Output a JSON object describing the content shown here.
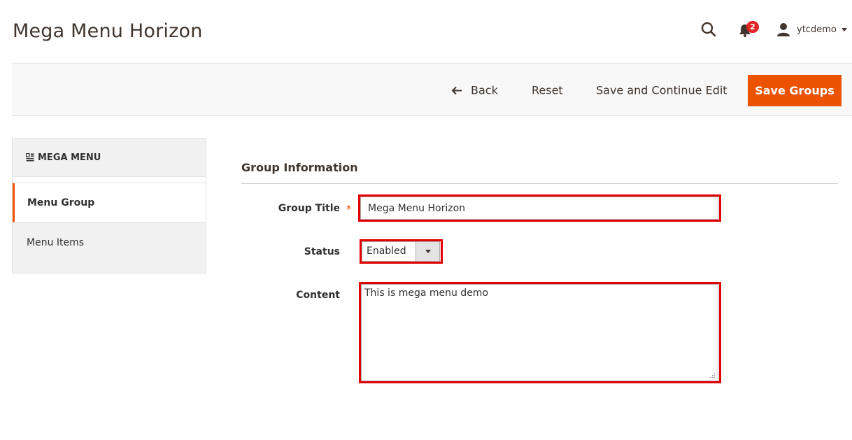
{
  "header": {
    "title": "Mega Menu Horizon",
    "notifications_count": "2",
    "user_name": "ytcdemo",
    "icons": [
      "search-icon",
      "bell-icon",
      "user-icon",
      "chevron-down-icon"
    ]
  },
  "actions": {
    "back_label": "Back",
    "reset_label": "Reset",
    "save_continue_label": "Save and Continue Edit",
    "save_groups_label": "Save Groups"
  },
  "sidebar": {
    "title": "MEGA MENU",
    "items": [
      {
        "label": "Menu Group",
        "active": true
      },
      {
        "label": "Menu Items",
        "active": false
      }
    ]
  },
  "form": {
    "section_title": "Group Information",
    "group_title": {
      "label": "Group Title",
      "required_mark": "*",
      "value": "Mega Menu Horizon"
    },
    "status": {
      "label": "Status",
      "value": "Enabled"
    },
    "content": {
      "label": "Content",
      "value": "This is mega menu demo"
    }
  },
  "colors": {
    "accent": "#eb5202",
    "highlight": "#e30000",
    "badge": "#e22626",
    "text": "#41362f"
  }
}
